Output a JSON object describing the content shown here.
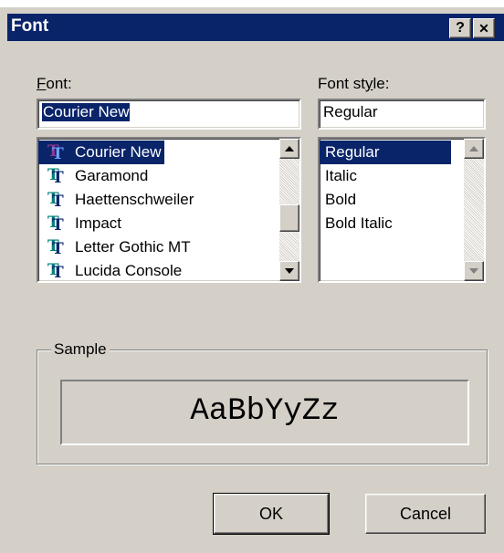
{
  "window": {
    "title": "Font",
    "help_glyph": "?",
    "close_glyph": "✕"
  },
  "font": {
    "label_underlined": "F",
    "label_rest": "ont:",
    "value": "Courier New",
    "items": [
      "Courier New",
      "Garamond",
      "Haettenschweiler",
      "Impact",
      "Letter Gothic MT",
      "Lucida Console"
    ],
    "selected_index": 0
  },
  "font_style": {
    "label_before": "Font st",
    "label_underlined": "y",
    "label_after": "le:",
    "value": "Regular",
    "items": [
      "Regular",
      "Italic",
      "Bold",
      "Bold Italic"
    ],
    "selected_index": 0
  },
  "sample": {
    "legend": "Sample",
    "text": "AaBbYyZz"
  },
  "buttons": {
    "ok": "OK",
    "cancel": "Cancel"
  },
  "icons": {
    "font_item": "truetype-icon",
    "scroll_up": "arrow-up-icon",
    "scroll_down": "arrow-down-icon"
  },
  "colors": {
    "titlebar": "#0a246a",
    "dialog_face": "#d4d0c8",
    "selection": "#0a246a"
  }
}
